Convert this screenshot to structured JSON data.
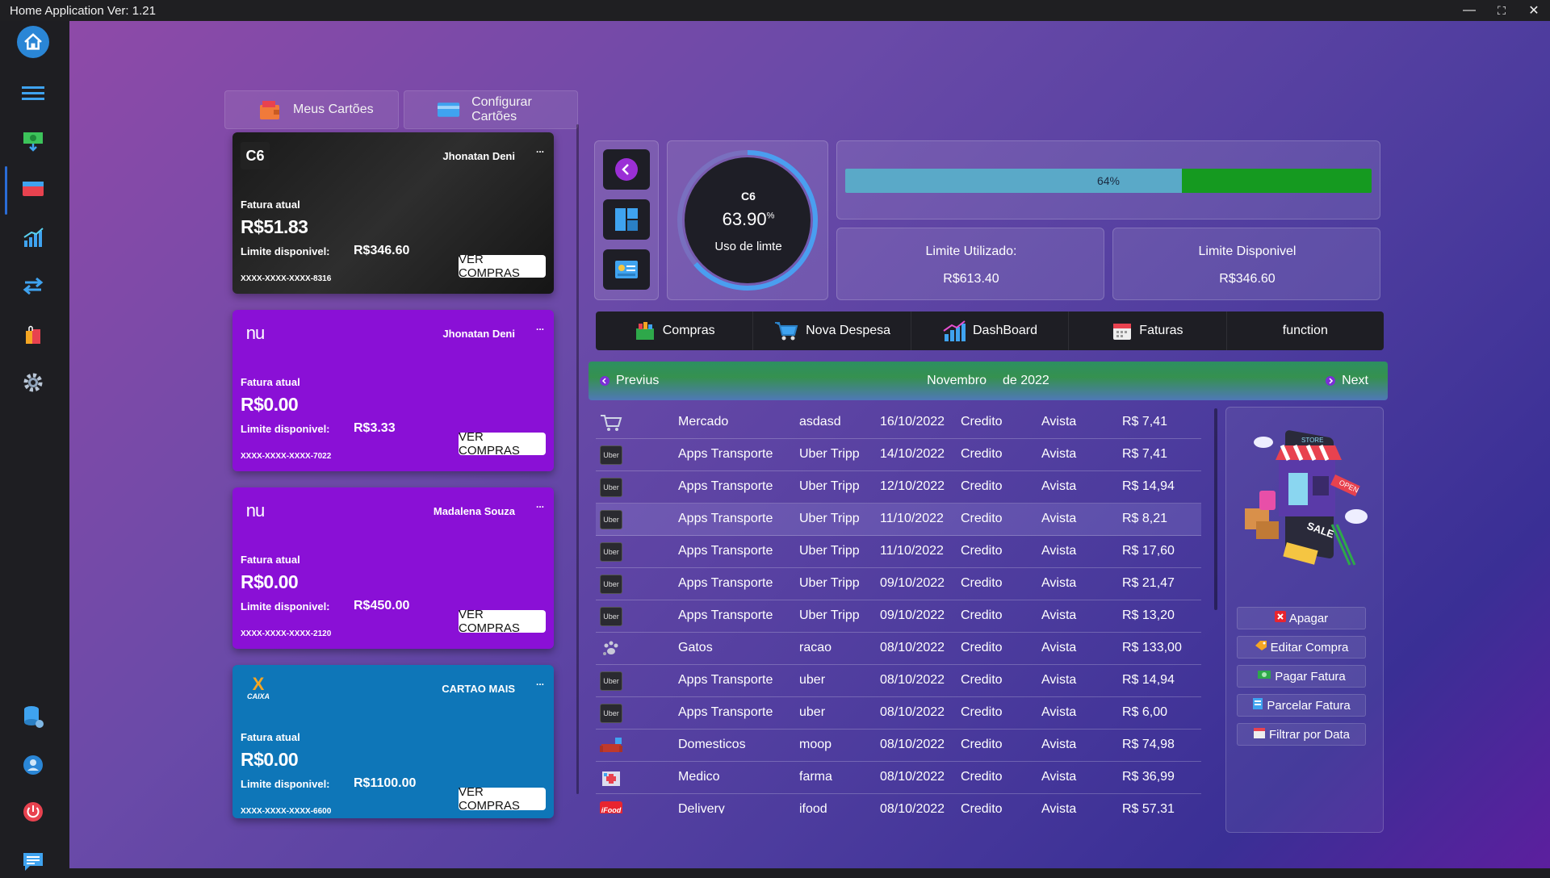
{
  "window": {
    "title": "Home Application Ver: 1.21"
  },
  "sidebar": {
    "items": [
      {
        "icon": "home-icon"
      },
      {
        "icon": "menu-icon"
      },
      {
        "icon": "money-icon"
      },
      {
        "icon": "credit-card-icon"
      },
      {
        "icon": "chart-icon"
      },
      {
        "icon": "transfer-icon"
      },
      {
        "icon": "shopping-icon"
      },
      {
        "icon": "gear-icon"
      },
      {
        "icon": "database-icon"
      },
      {
        "icon": "user-icon"
      },
      {
        "icon": "power-icon"
      },
      {
        "icon": "chat-icon"
      }
    ]
  },
  "top_buttons": {
    "meus_cartoes": "Meus Cartões",
    "configurar_cartoes": "Configurar Cartões"
  },
  "cards": [
    {
      "bank": "C6",
      "owner": "Jhonatan Deni",
      "dots": "...",
      "fatura_label": "Fatura atual",
      "fatura": "R$51.83",
      "limite_label": "Limite disponivel:",
      "limite": "R$346.60",
      "number": "XXXX-XXXX-XXXX-8316",
      "button": "VER COMPRAS",
      "color": "#1c1c1c"
    },
    {
      "bank": "nu",
      "owner": "Jhonatan Deni",
      "dots": "...",
      "fatura_label": "Fatura atual",
      "fatura": "R$0.00",
      "limite_label": "Limite disponivel:",
      "limite": "R$3.33",
      "number": "XXXX-XXXX-XXXX-7022",
      "button": "VER COMPRAS",
      "color": "#8a10d6"
    },
    {
      "bank": "nu",
      "owner": "Madalena Souza",
      "dots": "...",
      "fatura_label": "Fatura atual",
      "fatura": "R$0.00",
      "limite_label": "Limite disponivel:",
      "limite": "R$450.00",
      "number": "XXXX-XXXX-XXXX-2120",
      "button": "VER COMPRAS",
      "color": "#8a10d6"
    },
    {
      "bank": "CAIXA",
      "owner": "CARTAO MAIS",
      "dots": "...",
      "fatura_label": "Fatura atual",
      "fatura": "R$0.00",
      "limite_label": "Limite disponivel:",
      "limite": "R$1100.00",
      "number": "XXXX-XXXX-XXXX-6600",
      "button": "VER COMPRAS",
      "color": "#0e76b8"
    }
  ],
  "gauge": {
    "bank": "C6",
    "value": "63.90",
    "unit": "%",
    "label": "Uso de limte",
    "fraction": 0.639
  },
  "usage_bar": {
    "label": "64%",
    "fraction": 0.64
  },
  "limits": {
    "used_label": "Limite Utilizado:",
    "used_value": "R$613.40",
    "available_label": "Limite Disponivel",
    "available_value": "R$346.60"
  },
  "tabs": [
    {
      "label": "Compras",
      "icon": "basket-icon"
    },
    {
      "label": "Nova Despesa",
      "icon": "cart-icon"
    },
    {
      "label": "DashBoard",
      "icon": "chart-icon"
    },
    {
      "label": "Faturas",
      "icon": "calendar-icon"
    },
    {
      "label": "function",
      "icon": ""
    }
  ],
  "month_nav": {
    "prev": "Previus",
    "month": "Novembro",
    "year": "de 2022",
    "next": "Next"
  },
  "purchases": [
    {
      "icon": "cart-icon",
      "cat": "Mercado",
      "desc": "asdasd",
      "date": "16/10/2022",
      "type": "Credito",
      "mode": "Avista",
      "value": "R$ 7,41"
    },
    {
      "icon": "uber-icon",
      "cat": "Apps Transporte",
      "desc": "Uber Tripp",
      "date": "14/10/2022",
      "type": "Credito",
      "mode": "Avista",
      "value": "R$ 7,41"
    },
    {
      "icon": "uber-icon",
      "cat": "Apps Transporte",
      "desc": "Uber Tripp",
      "date": "12/10/2022",
      "type": "Credito",
      "mode": "Avista",
      "value": "R$ 14,94"
    },
    {
      "icon": "uber-icon",
      "cat": "Apps Transporte",
      "desc": "Uber Tripp",
      "date": "11/10/2022",
      "type": "Credito",
      "mode": "Avista",
      "value": "R$ 8,21",
      "selected": true
    },
    {
      "icon": "uber-icon",
      "cat": "Apps Transporte",
      "desc": "Uber Tripp",
      "date": "11/10/2022",
      "type": "Credito",
      "mode": "Avista",
      "value": "R$ 17,60"
    },
    {
      "icon": "uber-icon",
      "cat": "Apps Transporte",
      "desc": "Uber Tripp",
      "date": "09/10/2022",
      "type": "Credito",
      "mode": "Avista",
      "value": "R$ 21,47"
    },
    {
      "icon": "uber-icon",
      "cat": "Apps Transporte",
      "desc": "Uber Tripp",
      "date": "09/10/2022",
      "type": "Credito",
      "mode": "Avista",
      "value": "R$ 13,20"
    },
    {
      "icon": "paw-icon",
      "cat": "Gatos",
      "desc": "racao",
      "date": "08/10/2022",
      "type": "Credito",
      "mode": "Avista",
      "value": "R$ 133,00"
    },
    {
      "icon": "uber-icon",
      "cat": "Apps Transporte",
      "desc": "uber",
      "date": "08/10/2022",
      "type": "Credito",
      "mode": "Avista",
      "value": "R$ 14,94"
    },
    {
      "icon": "uber-icon",
      "cat": "Apps Transporte",
      "desc": "uber",
      "date": "08/10/2022",
      "type": "Credito",
      "mode": "Avista",
      "value": "R$ 6,00"
    },
    {
      "icon": "sofa-icon",
      "cat": "Domesticos",
      "desc": "moop",
      "date": "08/10/2022",
      "type": "Credito",
      "mode": "Avista",
      "value": "R$ 74,98"
    },
    {
      "icon": "hospital-icon",
      "cat": "Medico",
      "desc": "farma",
      "date": "08/10/2022",
      "type": "Credito",
      "mode": "Avista",
      "value": "R$ 36,99"
    },
    {
      "icon": "ifood-icon",
      "cat": "Delivery",
      "desc": "ifood",
      "date": "08/10/2022",
      "type": "Credito",
      "mode": "Avista",
      "value": "R$ 57,31"
    }
  ],
  "uber_text": "Uber",
  "ifood_text": "iFood",
  "actions": [
    {
      "label": "Apagar",
      "icon": "delete-icon"
    },
    {
      "label": "Editar Compra",
      "icon": "tag-icon"
    },
    {
      "label": "Pagar Fatura",
      "icon": "cash-icon"
    },
    {
      "label": "Parcelar Fatura",
      "icon": "card-icon"
    },
    {
      "label": "Filtrar por Data",
      "icon": "calendar-icon"
    }
  ],
  "illustration": {
    "sale": "SALE",
    "open": "OPEN",
    "store": "STORE"
  }
}
